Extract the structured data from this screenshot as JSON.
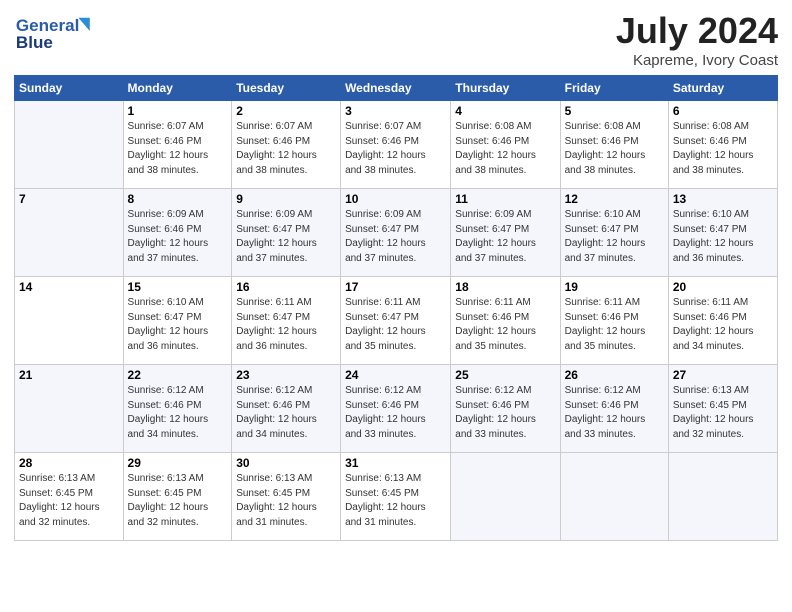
{
  "header": {
    "logo_line1": "General",
    "logo_line2": "Blue",
    "main_title": "July 2024",
    "sub_title": "Kapreme, Ivory Coast"
  },
  "days_header": [
    "Sunday",
    "Monday",
    "Tuesday",
    "Wednesday",
    "Thursday",
    "Friday",
    "Saturday"
  ],
  "weeks": [
    [
      {
        "num": "",
        "info": ""
      },
      {
        "num": "1",
        "info": "Sunrise: 6:07 AM\nSunset: 6:46 PM\nDaylight: 12 hours\nand 38 minutes."
      },
      {
        "num": "2",
        "info": "Sunrise: 6:07 AM\nSunset: 6:46 PM\nDaylight: 12 hours\nand 38 minutes."
      },
      {
        "num": "3",
        "info": "Sunrise: 6:07 AM\nSunset: 6:46 PM\nDaylight: 12 hours\nand 38 minutes."
      },
      {
        "num": "4",
        "info": "Sunrise: 6:08 AM\nSunset: 6:46 PM\nDaylight: 12 hours\nand 38 minutes."
      },
      {
        "num": "5",
        "info": "Sunrise: 6:08 AM\nSunset: 6:46 PM\nDaylight: 12 hours\nand 38 minutes."
      },
      {
        "num": "6",
        "info": "Sunrise: 6:08 AM\nSunset: 6:46 PM\nDaylight: 12 hours\nand 38 minutes."
      }
    ],
    [
      {
        "num": "7",
        "info": ""
      },
      {
        "num": "8",
        "info": "Sunrise: 6:09 AM\nSunset: 6:46 PM\nDaylight: 12 hours\nand 37 minutes."
      },
      {
        "num": "9",
        "info": "Sunrise: 6:09 AM\nSunset: 6:47 PM\nDaylight: 12 hours\nand 37 minutes."
      },
      {
        "num": "10",
        "info": "Sunrise: 6:09 AM\nSunset: 6:47 PM\nDaylight: 12 hours\nand 37 minutes."
      },
      {
        "num": "11",
        "info": "Sunrise: 6:09 AM\nSunset: 6:47 PM\nDaylight: 12 hours\nand 37 minutes."
      },
      {
        "num": "12",
        "info": "Sunrise: 6:10 AM\nSunset: 6:47 PM\nDaylight: 12 hours\nand 37 minutes."
      },
      {
        "num": "13",
        "info": "Sunrise: 6:10 AM\nSunset: 6:47 PM\nDaylight: 12 hours\nand 36 minutes."
      }
    ],
    [
      {
        "num": "14",
        "info": ""
      },
      {
        "num": "15",
        "info": "Sunrise: 6:10 AM\nSunset: 6:47 PM\nDaylight: 12 hours\nand 36 minutes."
      },
      {
        "num": "16",
        "info": "Sunrise: 6:11 AM\nSunset: 6:47 PM\nDaylight: 12 hours\nand 36 minutes."
      },
      {
        "num": "17",
        "info": "Sunrise: 6:11 AM\nSunset: 6:47 PM\nDaylight: 12 hours\nand 35 minutes."
      },
      {
        "num": "18",
        "info": "Sunrise: 6:11 AM\nSunset: 6:46 PM\nDaylight: 12 hours\nand 35 minutes."
      },
      {
        "num": "19",
        "info": "Sunrise: 6:11 AM\nSunset: 6:46 PM\nDaylight: 12 hours\nand 35 minutes."
      },
      {
        "num": "20",
        "info": "Sunrise: 6:11 AM\nSunset: 6:46 PM\nDaylight: 12 hours\nand 34 minutes."
      }
    ],
    [
      {
        "num": "21",
        "info": ""
      },
      {
        "num": "22",
        "info": "Sunrise: 6:12 AM\nSunset: 6:46 PM\nDaylight: 12 hours\nand 34 minutes."
      },
      {
        "num": "23",
        "info": "Sunrise: 6:12 AM\nSunset: 6:46 PM\nDaylight: 12 hours\nand 34 minutes."
      },
      {
        "num": "24",
        "info": "Sunrise: 6:12 AM\nSunset: 6:46 PM\nDaylight: 12 hours\nand 33 minutes."
      },
      {
        "num": "25",
        "info": "Sunrise: 6:12 AM\nSunset: 6:46 PM\nDaylight: 12 hours\nand 33 minutes."
      },
      {
        "num": "26",
        "info": "Sunrise: 6:12 AM\nSunset: 6:46 PM\nDaylight: 12 hours\nand 33 minutes."
      },
      {
        "num": "27",
        "info": "Sunrise: 6:13 AM\nSunset: 6:45 PM\nDaylight: 12 hours\nand 32 minutes."
      }
    ],
    [
      {
        "num": "28",
        "info": "Sunrise: 6:13 AM\nSunset: 6:45 PM\nDaylight: 12 hours\nand 32 minutes."
      },
      {
        "num": "29",
        "info": "Sunrise: 6:13 AM\nSunset: 6:45 PM\nDaylight: 12 hours\nand 32 minutes."
      },
      {
        "num": "30",
        "info": "Sunrise: 6:13 AM\nSunset: 6:45 PM\nDaylight: 12 hours\nand 31 minutes."
      },
      {
        "num": "31",
        "info": "Sunrise: 6:13 AM\nSunset: 6:45 PM\nDaylight: 12 hours\nand 31 minutes."
      },
      {
        "num": "",
        "info": ""
      },
      {
        "num": "",
        "info": ""
      },
      {
        "num": "",
        "info": ""
      }
    ]
  ]
}
